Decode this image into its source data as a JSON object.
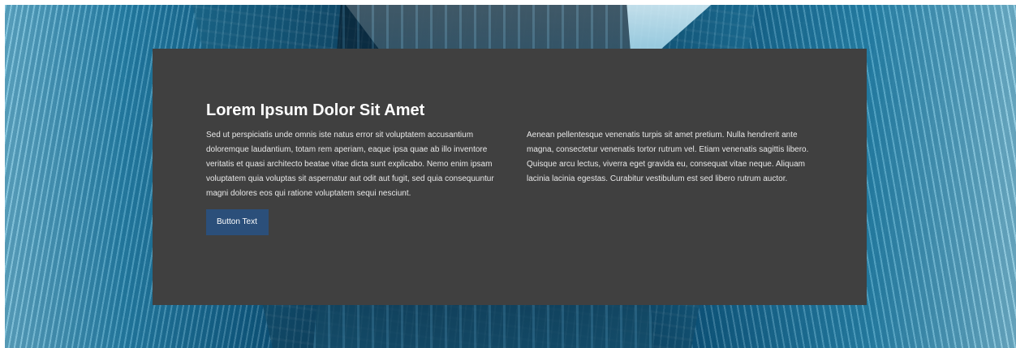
{
  "hero": {
    "title": "Lorem Ipsum Dolor Sit Amet",
    "left_paragraph": "Sed ut perspiciatis unde omnis iste natus error sit voluptatem accusantium doloremque laudantium, totam rem aperiam, eaque ipsa quae ab illo inventore veritatis et quasi architecto beatae vitae dicta sunt explicabo. Nemo enim ipsam voluptatem quia voluptas sit aspernatur aut odit aut fugit, sed quia consequuntur magni dolores eos qui ratione voluptatem sequi nesciunt.",
    "right_paragraph": "Aenean pellentesque venenatis turpis sit amet pretium. Nulla hendrerit ante magna, consectetur venenatis tortor rutrum vel. Etiam venenatis sagittis libero. Quisque arcu lectus, viverra eget gravida eu, consequat vitae neque. Aliquam lacinia lacinia egestas. Curabitur vestibulum est sed libero rutrum auctor.",
    "button_label": "Button Text"
  },
  "colors": {
    "card_background": "#404040",
    "button_background": "#2b4f7a",
    "text": "#ffffff"
  }
}
